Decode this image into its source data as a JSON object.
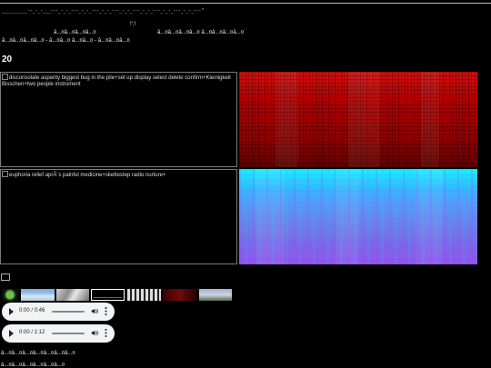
{
  "top_line_text": "__________--_-_-___---_-_-_---_-_-_---_-_-_---_-_-_---_-_-_---_-_-_---_-_-_---\"",
  "small_mark": "!';!",
  "row_a_left": "â...¤â...¤â...¤â...¤",
  "row_a_right": "â...¤â...¤â...¤â...¤  â...¤â...¤â...¤â...¤",
  "row_b": "â...¤â...¤â...¤â...¤ - â...¤â...¤ â...¤â...¤ - â...¤â...¤â...¤",
  "heading": "20",
  "image1_alt": "disconsolate asperity biggest bug in the pile+set up display select delete confirm+Kleinigkeit Bisschen+two people instrument",
  "image2_alt": "euphoria relief aprÃ¨s painful medicine+skettestep radio nurture+",
  "audio_players": [
    {
      "time": "0:00 / 0:46",
      "progress": 0
    },
    {
      "time": "0:00 / 1:12",
      "progress": 0
    }
  ],
  "bottom_text_1": "â...¤â...¤â...¤â...¤â...¤â...¤â...¤",
  "bottom_text_2": "â...¤â...¤â...¤â...¤â...¤â...¤",
  "icons": {
    "broken_image": "broken-image-icon",
    "play": "play-icon",
    "volume": "volume-icon",
    "more": "more-options-icon"
  },
  "colors": {
    "background": "#000000",
    "spectrogram_red": "#b40000",
    "spectrogram_cyan": "#12f3ff",
    "spectrogram_violet": "#9452ee",
    "audio_bg": "#f1f3f4"
  }
}
